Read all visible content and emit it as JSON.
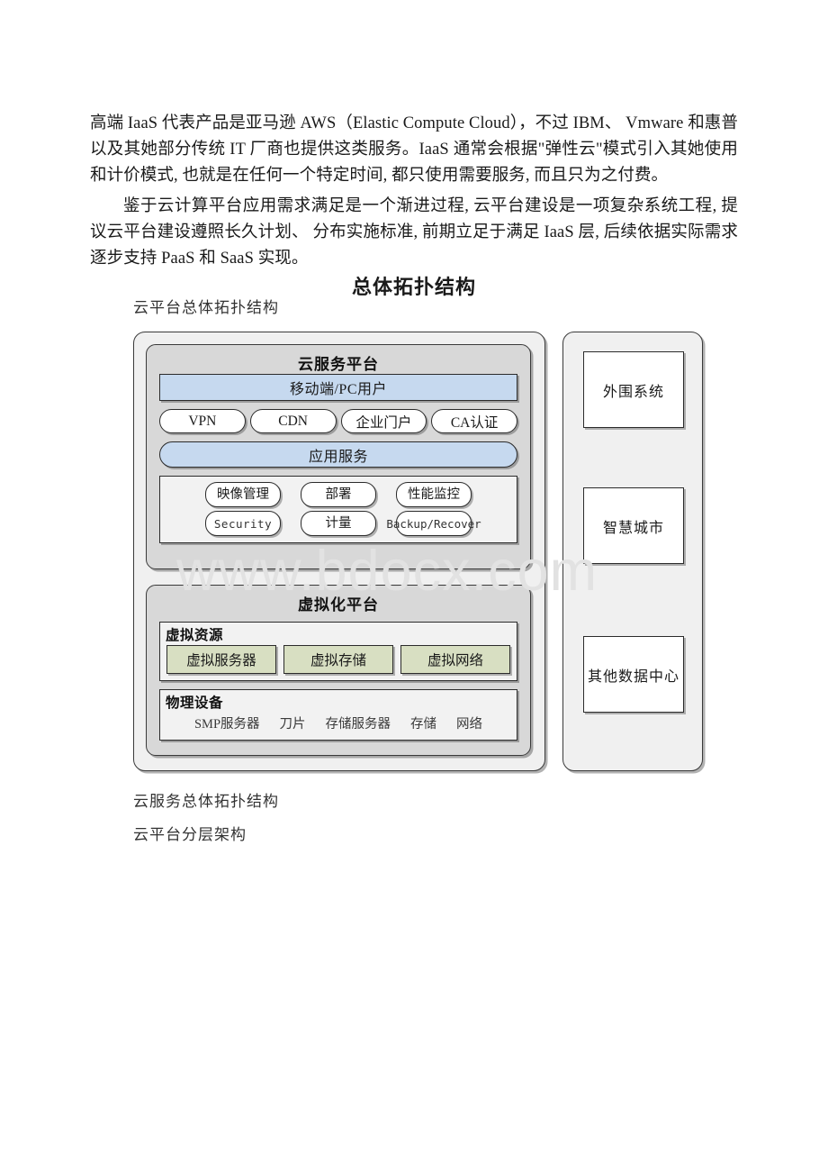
{
  "document": {
    "paragraph_1": "高端 IaaS 代表产品是亚马逊 AWS（Elastic Compute Cloud），不过 IBM、 Vmware 和惠普以及其她部分传统 IT 厂商也提供这类服务。IaaS 通常会根据\"弹性云\"模式引入其她使用和计价模式, 也就是在任何一个特定时间, 都只使用需要服务, 而且只为之付费。",
    "paragraph_2": "鉴于云计算平台应用需求满足是一个渐进过程, 云平台建设是一项复杂系统工程, 提议云平台建设遵照长久计划、 分布实施标准, 前期立足于满足 IaaS 层, 后续依据实际需求逐步支持 PaaS 和 SaaS 实现。",
    "section_heading": "总体拓扑结构",
    "caption_top": "云平台总体拓扑结构",
    "caption_bottom": "云服务总体拓扑结构",
    "caption_last": "云平台分层架构",
    "watermark": "www.bdocx.com"
  },
  "diagram": {
    "cloud_platform": {
      "title": "云服务平台",
      "user_bar": "移动端/PC用户",
      "access_pills": [
        "VPN",
        "CDN",
        "企业门户",
        "CA认证"
      ],
      "app_service_bar": "应用服务",
      "management": {
        "row_1": [
          "映像管理",
          "部署",
          "性能监控"
        ],
        "row_2": [
          "Security",
          "计量",
          "Backup/Recover"
        ]
      }
    },
    "virtualization_platform": {
      "title": "虚拟化平台",
      "virtual_resources": {
        "title": "虚拟资源",
        "items": [
          "虚拟服务器",
          "虚拟存储",
          "虚拟网络"
        ]
      },
      "physical_devices": {
        "title": "物理设备",
        "items": [
          "SMP服务器",
          "刀片",
          "存储服务器",
          "存储",
          "网络"
        ]
      }
    },
    "external_column": {
      "boxes": [
        "外围系统",
        "智慧城市",
        "其他数据中心"
      ]
    },
    "colors": {
      "blue_fill": "#c6d9ef",
      "green_fill": "#d8dfc2",
      "group_fill": "#d8d8d8",
      "panel_fill": "#f0f0f0",
      "sub_box_fill": "#f2f2f2",
      "border": "#2b2b2b"
    }
  }
}
